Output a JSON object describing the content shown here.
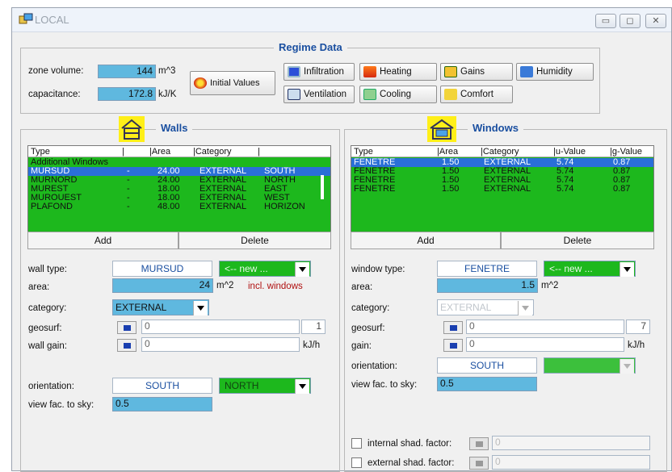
{
  "window": {
    "title": "LOCAL"
  },
  "regime": {
    "title": "Regime Data",
    "zone_volume_label": "zone volume:",
    "zone_volume_value": "144",
    "zone_volume_unit": "m^3",
    "capacitance_label": "capacitance:",
    "capacitance_value": "172.8",
    "capacitance_unit": "kJ/K",
    "initial_values": "Initial Values",
    "infiltration": "Infiltration",
    "heating": "Heating",
    "gains": "Gains",
    "humidity": "Humidity",
    "ventilation": "Ventilation",
    "cooling": "Cooling",
    "comfort": "Comfort"
  },
  "walls": {
    "title": "Walls",
    "headers": [
      "Type",
      "|",
      "|Area",
      "|Category",
      "|"
    ],
    "rows": [
      {
        "type": "Additional Windows",
        "dash": "",
        "area": "",
        "category": "",
        "orientation": ""
      },
      {
        "type": "MURSUD",
        "dash": "-",
        "area": "24.00",
        "category": "EXTERNAL",
        "orientation": "SOUTH"
      },
      {
        "type": "MURNORD",
        "dash": "-",
        "area": "24.00",
        "category": "EXTERNAL",
        "orientation": "NORTH"
      },
      {
        "type": "MUREST",
        "dash": "-",
        "area": "18.00",
        "category": "EXTERNAL",
        "orientation": "EAST"
      },
      {
        "type": "MUROUEST",
        "dash": "-",
        "area": "18.00",
        "category": "EXTERNAL",
        "orientation": "WEST"
      },
      {
        "type": "PLAFOND",
        "dash": "-",
        "area": "48.00",
        "category": "EXTERNAL",
        "orientation": "HORIZON"
      }
    ],
    "add": "Add",
    "delete": "Delete",
    "wall_type_label": "wall type:",
    "wall_type_value": "MURSUD",
    "wall_type_select": "<-- new ...",
    "area_label": "area:",
    "area_value": "24",
    "area_unit": "m^2",
    "incl_windows": "incl. windows",
    "category_label": "category:",
    "category_value": "EXTERNAL",
    "geosurf_label": "geosurf:",
    "geosurf_value": "0",
    "geosurf_right": "1",
    "wall_gain_label": "wall gain:",
    "wall_gain_value": "0",
    "wall_gain_unit": "kJ/h",
    "orientation_label": "orientation:",
    "orientation_value": "SOUTH",
    "orientation_select": "NORTH",
    "view_fac_label": "view fac. to sky:",
    "view_fac_value": "0.5"
  },
  "windows": {
    "title": "Windows",
    "headers": [
      "Type",
      "|Area",
      "|Category",
      "|u-Value",
      "|g-Value"
    ],
    "rows": [
      {
        "type": "FENETRE",
        "area": "1.50",
        "category": "EXTERNAL",
        "u": "5.74",
        "g": "0.87"
      },
      {
        "type": "FENETRE",
        "area": "1.50",
        "category": "EXTERNAL",
        "u": "5.74",
        "g": "0.87"
      },
      {
        "type": "FENETRE",
        "area": "1.50",
        "category": "EXTERNAL",
        "u": "5.74",
        "g": "0.87"
      },
      {
        "type": "FENETRE",
        "area": "1.50",
        "category": "EXTERNAL",
        "u": "5.74",
        "g": "0.87"
      }
    ],
    "add": "Add",
    "delete": "Delete",
    "window_type_label": "window type:",
    "window_type_value": "FENETRE",
    "window_type_select": "<-- new ...",
    "area_label": "area:",
    "area_value": "1.5",
    "area_unit": "m^2",
    "category_label": "category:",
    "category_value": "EXTERNAL",
    "geosurf_label": "geosurf:",
    "geosurf_value": "0",
    "geosurf_right": "7",
    "gain_label": "gain:",
    "gain_value": "0",
    "gain_unit": "kJ/h",
    "orientation_label": "orientation:",
    "orientation_value": "SOUTH",
    "view_fac_label": "view fac. to sky:",
    "view_fac_value": "0.5",
    "internal_shad": "internal shad. factor:",
    "internal_shad_value": "0",
    "external_shad": "external shad. factor:",
    "external_shad_value": "0"
  },
  "colors": {
    "green": "#1db81d",
    "cyan": "#5fb8df",
    "selection": "#2a6fd8",
    "title_blue": "#1a4fa0"
  }
}
